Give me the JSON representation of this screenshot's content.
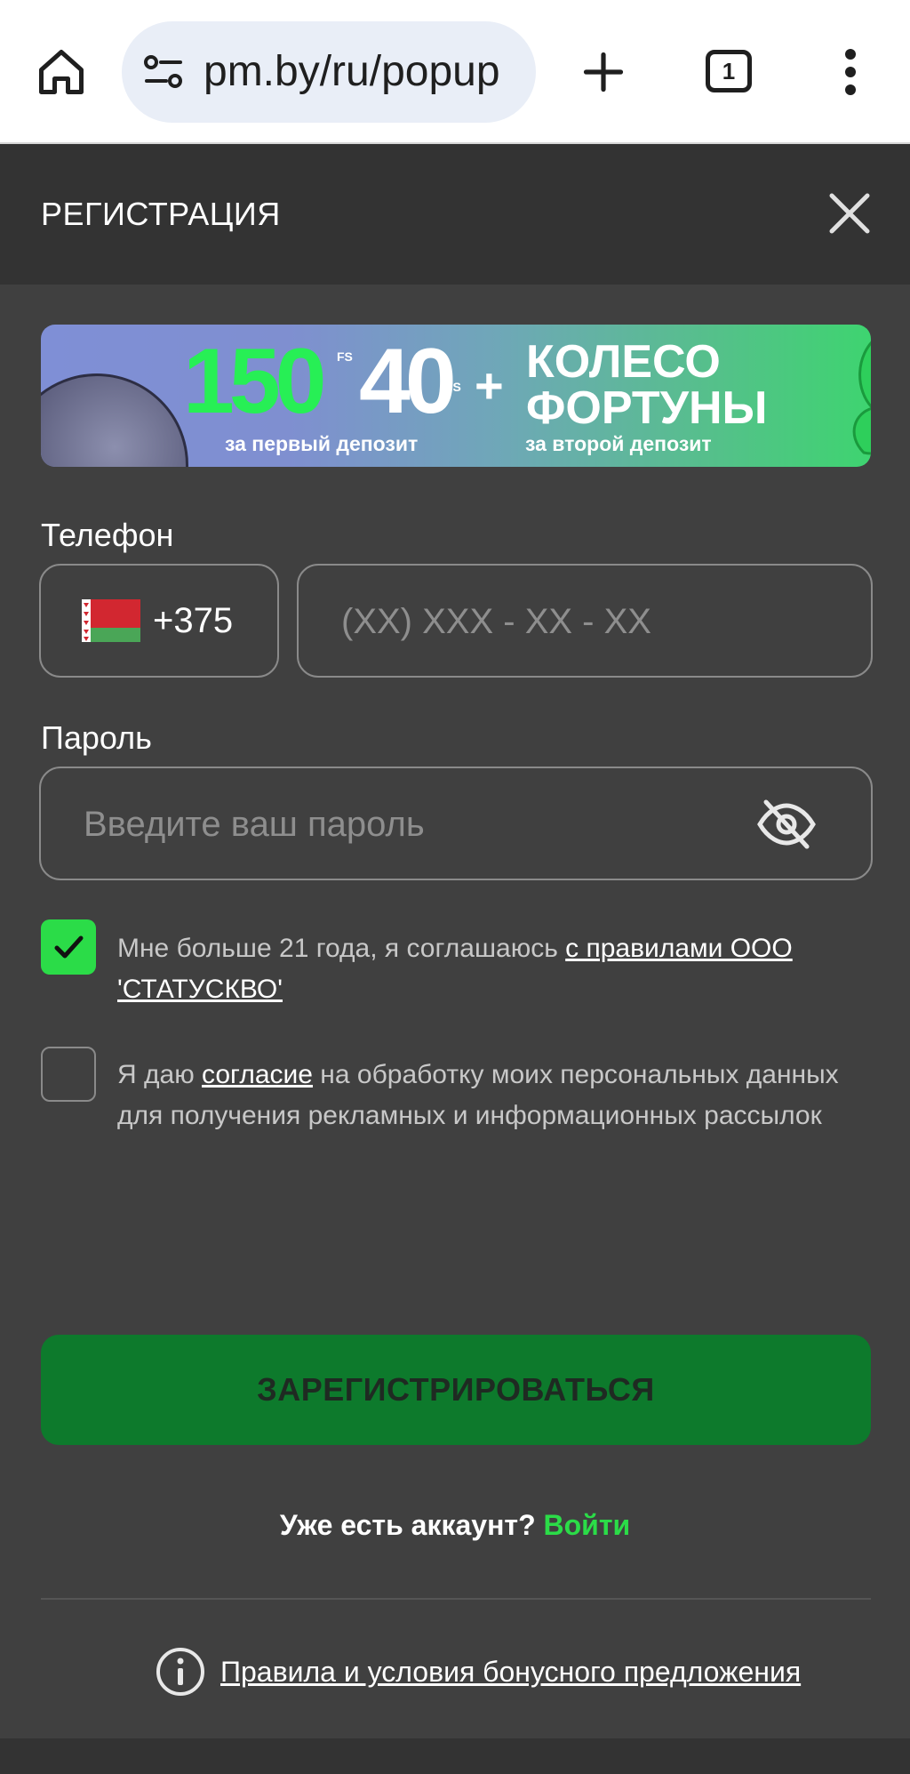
{
  "browser": {
    "url": "pm.by/ru/popup",
    "tab_count": "1"
  },
  "modal": {
    "title": "РЕГИСТРАЦИЯ"
  },
  "banner": {
    "big_number_1": "150",
    "fs_label": "FS",
    "big_number_2": "40",
    "fs_label_2": "FS",
    "plus": "+",
    "prize_line_1": "КОЛЕСО",
    "prize_line_2": "ФОРТУНЫ",
    "caption_1": "за первый депозит",
    "caption_2": "за второй депозит"
  },
  "form": {
    "phone_label": "Телефон",
    "country_code": "+375",
    "phone_placeholder": "(XX) XXX - XX - XX",
    "password_label": "Пароль",
    "password_placeholder": "Введите ваш пароль",
    "consent_1_text": "Мне больше 21 года, я соглашаюсь ",
    "consent_1_link": "с правилами ООО 'СТАТУСКВО'",
    "consent_1_checked": true,
    "consent_2_prefix": "Я даю ",
    "consent_2_link": "согласие",
    "consent_2_suffix": " на обработку моих персональных данных для получения рекламных и информационных рассылок",
    "consent_2_checked": false,
    "register_label": "ЗАРЕГИСТРИРОВАТЬСЯ",
    "have_account_text": "Уже есть аккаунт?",
    "login_label": "Войти",
    "rules_link": "Правила и условия бонусного предложения"
  },
  "colors": {
    "background": "#404040",
    "header": "#333333",
    "accent_green": "#2bdc48",
    "button_green": "#0d7a2c"
  }
}
